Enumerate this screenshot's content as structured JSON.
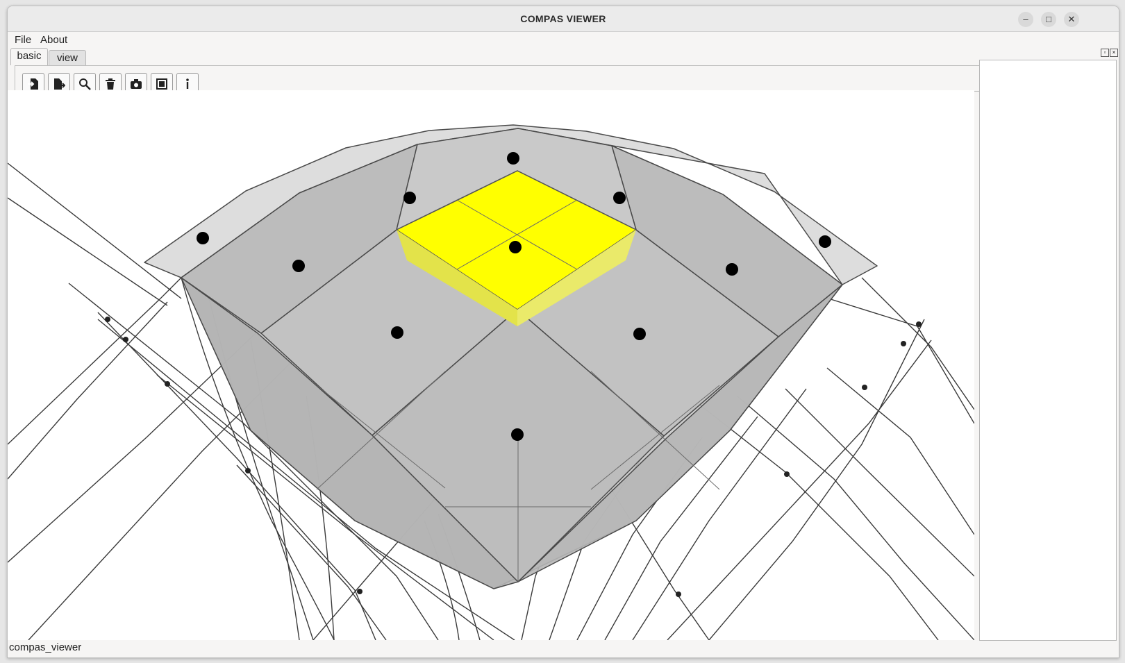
{
  "window": {
    "title": "COMPAS VIEWER"
  },
  "menu": {
    "file": "File",
    "about": "About"
  },
  "tabs": [
    {
      "label": "basic",
      "active": true
    },
    {
      "label": "view",
      "active": false
    }
  ],
  "toolbar": [
    {
      "icon": "open-file-icon",
      "tooltip": ""
    },
    {
      "icon": "export-file-icon",
      "tooltip": ""
    },
    {
      "icon": "zoom-extents-icon",
      "tooltip": ""
    },
    {
      "icon": "delete-icon",
      "tooltip": ""
    },
    {
      "icon": "screenshot-camera-icon",
      "tooltip": ""
    },
    {
      "icon": "select-window-icon",
      "tooltip": ""
    },
    {
      "icon": "info-icon",
      "tooltip": ""
    }
  ],
  "status": {
    "text": "compas_viewer"
  },
  "colors": {
    "highlight": "#ffff00",
    "mesh": "#bdbdbd",
    "lines": "#3a3a3a",
    "points": "#000000"
  }
}
